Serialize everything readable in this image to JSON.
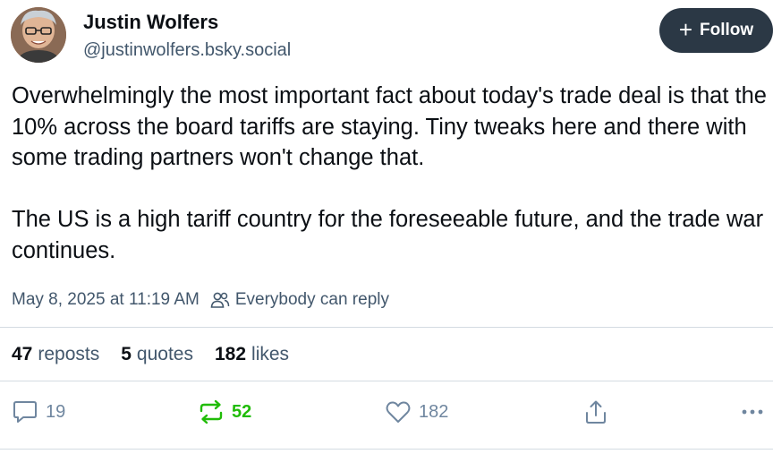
{
  "author": {
    "name": "Justin Wolfers",
    "handle": "@justinwolfers.bsky.social"
  },
  "follow_button": {
    "label": "Follow",
    "icon": "plus-icon"
  },
  "post": {
    "paragraphs": [
      "Overwhelmingly the most important fact about today's trade deal is that the 10% across the board tariffs are staying. Tiny tweaks here and there with some trading partners won't change that.",
      "The US is a high tariff country for the foreseeable future, and the trade war continues."
    ],
    "timestamp": "May 8, 2025 at 11:19 AM",
    "reply_setting": "Everybody can reply"
  },
  "stats": {
    "reposts_count": "47",
    "reposts_label": "reposts",
    "quotes_count": "5",
    "quotes_label": "quotes",
    "likes_count": "182",
    "likes_label": "likes"
  },
  "actions": {
    "reply_count": "19",
    "repost_count": "52",
    "like_count": "182"
  },
  "colors": {
    "text": "#0b0f14",
    "muted": "#42576c",
    "follow_bg": "#2b3845",
    "repost_active": "#20bc07",
    "icon": "#6f869f",
    "divider": "#d4dbe2"
  }
}
